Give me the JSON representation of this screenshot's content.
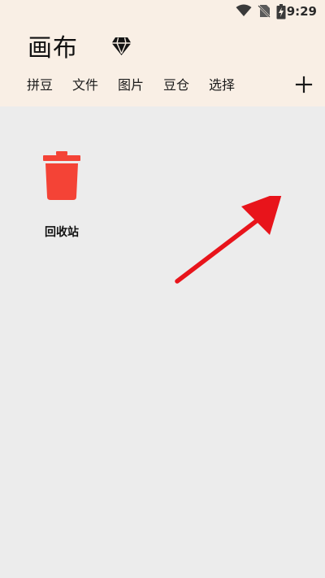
{
  "status_bar": {
    "time": "9:29",
    "icons": [
      "wifi-icon",
      "no-sim-icon",
      "battery-charging-icon"
    ]
  },
  "header": {
    "title": "画布",
    "premium_icon": "diamond-icon"
  },
  "tabs": [
    {
      "label": "拼豆"
    },
    {
      "label": "文件"
    },
    {
      "label": "图片"
    },
    {
      "label": "豆仓"
    },
    {
      "label": "选择"
    }
  ],
  "actions": {
    "add_icon": "plus-icon"
  },
  "items": [
    {
      "label": "回收站",
      "icon": "trash-icon"
    }
  ],
  "colors": {
    "appbar_bg": "#f9efe5",
    "content_bg": "#ececec",
    "trash_red": "#f44336",
    "arrow_red": "#e8141b"
  }
}
